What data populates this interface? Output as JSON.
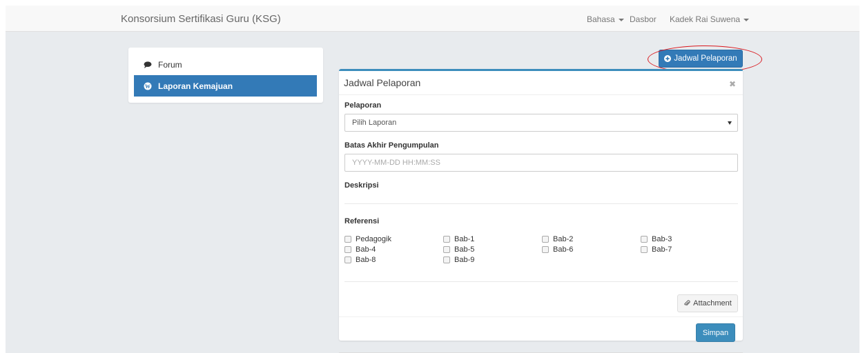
{
  "navbar": {
    "brand": "Konsorsium Sertifikasi Guru (KSG)",
    "language_label": "Bahasa",
    "dashboard_label": "Dasbor",
    "user_label": "Kadek Rai Suwena"
  },
  "sidebar": {
    "items": [
      {
        "label": "Forum",
        "icon": "comment-icon"
      },
      {
        "label": "Laporan Kemajuan",
        "icon": "wordpress-icon",
        "active": true
      }
    ]
  },
  "top_button": {
    "label": "Jadwal Pelaporan",
    "icon": "plus-circle-icon"
  },
  "panel": {
    "title": "Jadwal Pelaporan",
    "close_glyph": "✖",
    "pelaporan_label": "Pelaporan",
    "pelaporan_selected": "Pilih Laporan",
    "batas_label": "Batas Akhir Pengumpulan",
    "batas_placeholder": "YYYY-MM-DD HH:MM:SS",
    "deskripsi_label": "Deskripsi",
    "referensi_label": "Referensi",
    "referensi_items": [
      "Pedagogik",
      "Bab-1",
      "Bab-2",
      "Bab-3",
      "Bab-4",
      "Bab-5",
      "Bab-6",
      "Bab-7",
      "Bab-8",
      "Bab-9"
    ],
    "attachment_label": "Attachment",
    "save_label": "Simpan"
  },
  "colors": {
    "primary": "#337ab7",
    "panel_accent": "#3c8dbc",
    "highlight": "#d9161c"
  }
}
